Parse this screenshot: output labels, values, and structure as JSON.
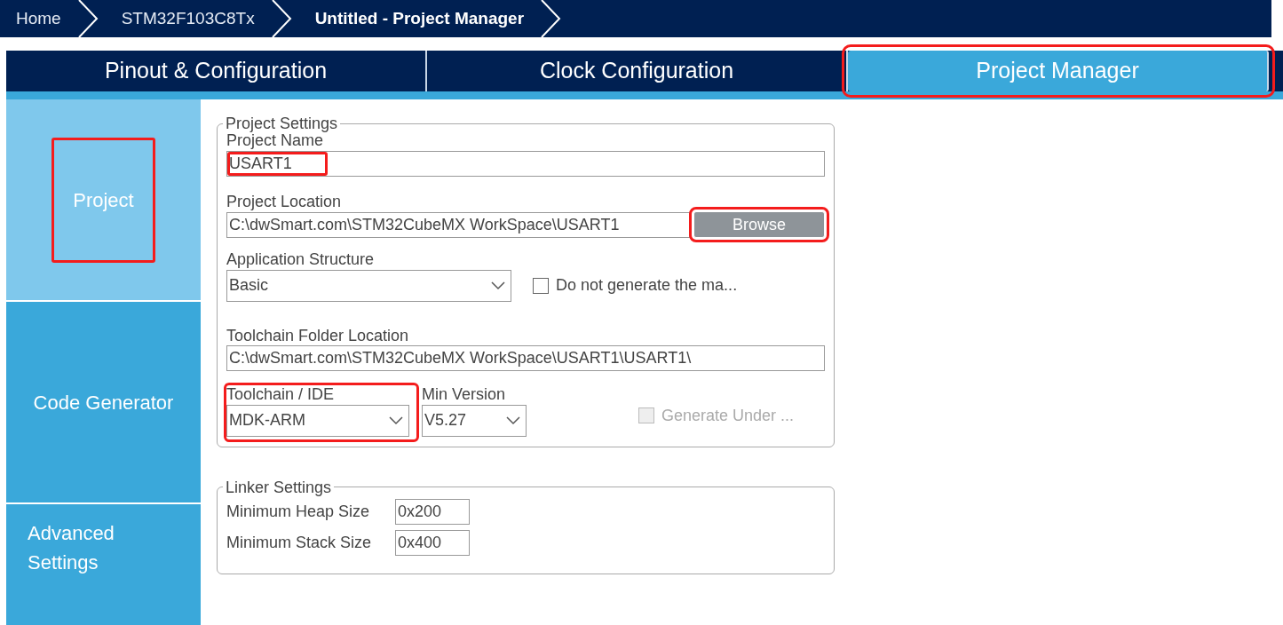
{
  "breadcrumb": [
    {
      "label": "Home",
      "current": false
    },
    {
      "label": "STM32F103C8Tx",
      "current": false
    },
    {
      "label": "Untitled - Project Manager",
      "current": true
    }
  ],
  "tabs": [
    {
      "label": "Pinout & Configuration",
      "selected": false,
      "highlighted": false
    },
    {
      "label": "Clock Configuration",
      "selected": false,
      "highlighted": false
    },
    {
      "label": "Project Manager",
      "selected": true,
      "highlighted": true
    }
  ],
  "sidebar": {
    "items": [
      {
        "label": "Project",
        "selected": true,
        "highlighted": true
      },
      {
        "label": "Code Generator",
        "selected": false,
        "highlighted": false
      },
      {
        "label": "Advanced Settings",
        "selected": false,
        "highlighted": false
      }
    ]
  },
  "project_settings": {
    "title": "Project Settings",
    "project_name": {
      "label": "Project Name",
      "value": "USART1",
      "highlighted": true
    },
    "project_location": {
      "label": "Project Location",
      "value": "C:\\dwSmart.com\\STM32CubeMX WorkSpace\\USART1"
    },
    "browse_button": {
      "label": "Browse",
      "highlighted": true
    },
    "application_structure": {
      "label": "Application Structure",
      "value": "Basic"
    },
    "do_not_generate": {
      "label": "Do not generate the ma...",
      "checked": false,
      "disabled": false
    },
    "toolchain_folder": {
      "label": "Toolchain Folder Location",
      "value": "C:\\dwSmart.com\\STM32CubeMX WorkSpace\\USART1\\USART1\\"
    },
    "toolchain_ide": {
      "label": "Toolchain / IDE",
      "value": "MDK-ARM",
      "highlighted": true
    },
    "min_version": {
      "label": "Min Version",
      "value": "V5.27"
    },
    "generate_under": {
      "label": "Generate Under ...",
      "checked": false,
      "disabled": true
    }
  },
  "linker_settings": {
    "title": "Linker Settings",
    "fields": [
      {
        "label": "Minimum Heap Size",
        "value": "0x200"
      },
      {
        "label": "Minimum Stack Size",
        "value": "0x400"
      }
    ]
  }
}
